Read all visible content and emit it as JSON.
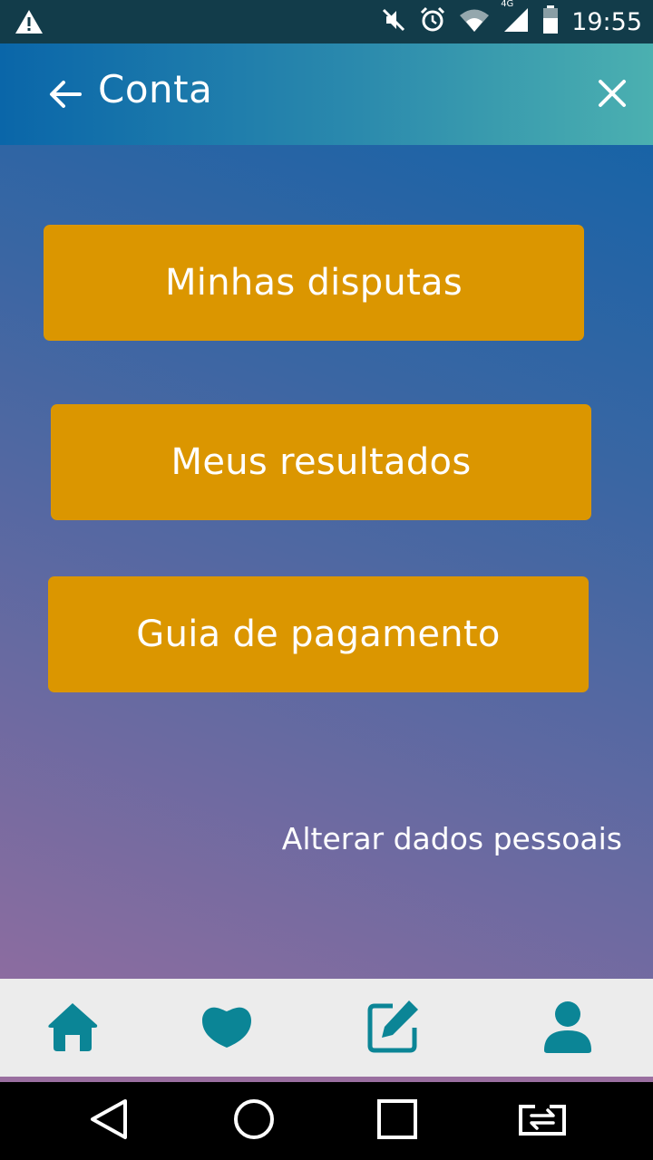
{
  "status_bar": {
    "time": "19:55",
    "network": "4G",
    "icons": [
      "warning-icon",
      "mute-icon",
      "alarm-icon",
      "wifi-icon",
      "signal-icon",
      "battery-icon"
    ]
  },
  "header": {
    "title": "Conta",
    "back_icon": "arrow-left-icon",
    "close_icon": "close-icon"
  },
  "menu": {
    "items": [
      {
        "label": "Minhas disputas"
      },
      {
        "label": "Meus resultados"
      },
      {
        "label": "Guia de pagamento"
      }
    ],
    "button_color": "#db9600"
  },
  "links": {
    "alter_personal_data": "Alterar dados pessoais"
  },
  "tab_bar": {
    "accent": "#0b8596",
    "items": [
      "home-icon",
      "heart-icon",
      "edit-icon",
      "profile-icon"
    ]
  },
  "nav_bar": {
    "items": [
      "back-icon",
      "home-circle-icon",
      "recents-icon",
      "switch-icon"
    ]
  }
}
